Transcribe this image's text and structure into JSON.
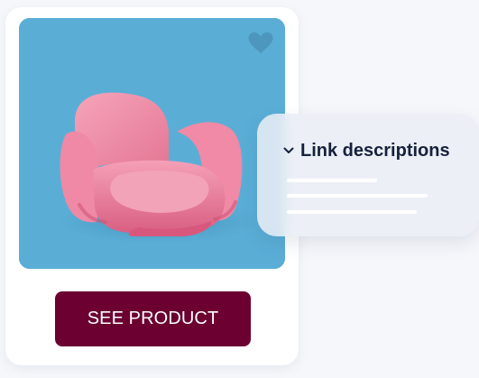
{
  "product_card": {
    "button_label": "SEE PRODUCT",
    "image_icon": "armchair-image",
    "favorite_icon": "heart-icon"
  },
  "link_panel": {
    "title": "Link descriptions",
    "toggle_icon": "chevron-down-icon"
  },
  "colors": {
    "page_background": "#f6f7fb",
    "card_background": "#ffffff",
    "image_background": "#5aaed6",
    "chair": "#f17fa0",
    "button": "#6b0031",
    "panel_background": "#eaeef5",
    "panel_text": "#16213d"
  }
}
